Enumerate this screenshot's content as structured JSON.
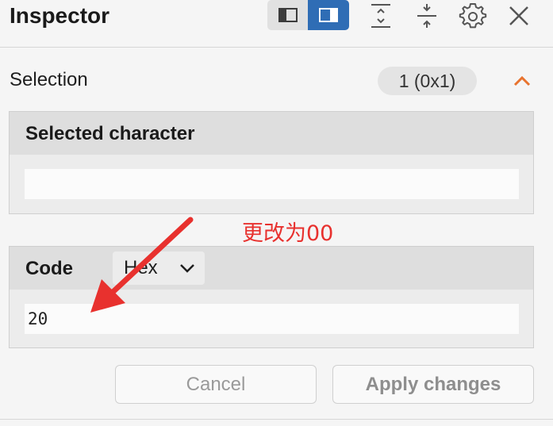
{
  "header": {
    "title": "Inspector",
    "icons": {
      "layout_left": "sidebar-left-layout-icon",
      "layout_right": "sidebar-right-layout-icon",
      "expand": "expand-vertical-icon",
      "collapse": "collapse-vertical-icon",
      "settings": "gear-icon",
      "close": "close-icon"
    },
    "active_layout": "right"
  },
  "selection": {
    "label": "Selection",
    "count_badge": "1 (0x1)",
    "toggle_icon": "chevron-up-icon"
  },
  "selected_character": {
    "title": "Selected character",
    "value": ""
  },
  "code": {
    "title": "Code",
    "format_selected": "Hex",
    "value": "20"
  },
  "buttons": {
    "cancel": "Cancel",
    "apply": "Apply changes"
  },
  "annotation": {
    "text": "更改为00",
    "color": "#e8312e"
  },
  "colors": {
    "accent": "#2f6db5",
    "collapse_chevron": "#e8732e"
  }
}
